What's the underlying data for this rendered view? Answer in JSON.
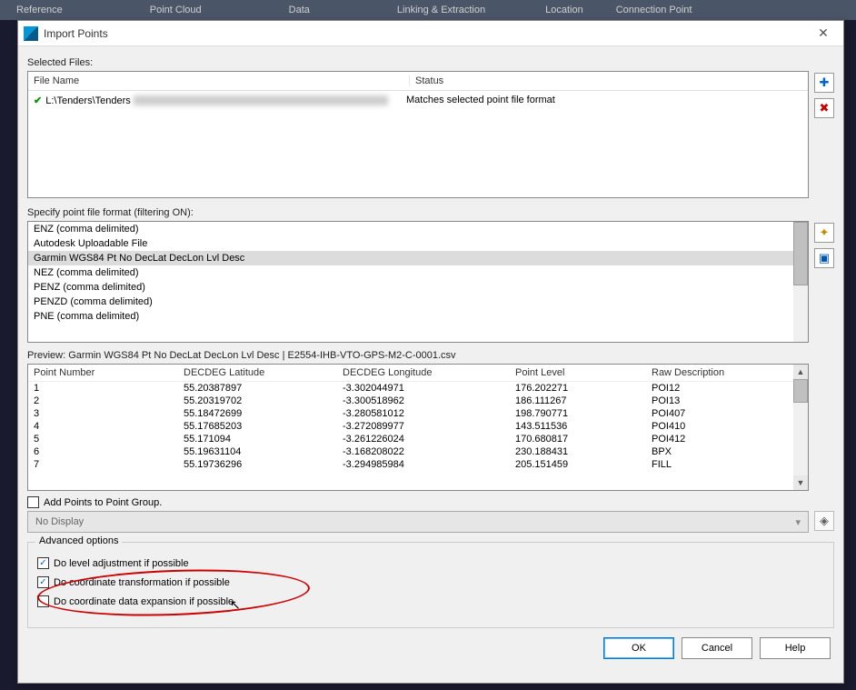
{
  "ribbon": {
    "items": [
      "Reference",
      "Point Cloud",
      "Data",
      "Linking & Extraction",
      "Location",
      "Connection Point"
    ]
  },
  "dialog": {
    "title": "Import Points",
    "close": "✕",
    "selected_files_label": "Selected Files:",
    "file_headers": {
      "name": "File Name",
      "status": "Status"
    },
    "files": [
      {
        "name": "L:\\Tenders\\Tenders",
        "status": "Matches selected point file format"
      }
    ],
    "side_add": "✚",
    "side_remove": "✖",
    "format_label": "Specify point file format (filtering ON):",
    "formats": [
      "ENZ (comma delimited)",
      "Autodesk Uploadable File",
      "Garmin WGS84 Pt No DecLat DecLon Lvl Desc",
      "NEZ (comma delimited)",
      "PENZ (comma delimited)",
      "PENZD (comma delimited)",
      "PNE (comma delimited)"
    ],
    "format_selected_index": 2,
    "side_fmt_a": "✦",
    "side_fmt_b": "▣",
    "preview_label": "Preview: Garmin WGS84 Pt No DecLat DecLon Lvl Desc | E2554-IHB-VTO-GPS-M2-C-0001.csv",
    "preview_headers": {
      "num": "Point Number",
      "lat": "DECDEG Latitude",
      "lon": "DECDEG Longitude",
      "lvl": "Point Level",
      "desc": "Raw Description"
    },
    "rows": [
      {
        "n": "1",
        "lat": "55.20387897",
        "lon": "-3.302044971",
        "lvl": "176.202271",
        "d": "POI12"
      },
      {
        "n": "2",
        "lat": "55.20319702",
        "lon": "-3.300518962",
        "lvl": "186.111267",
        "d": "POI13"
      },
      {
        "n": "3",
        "lat": "55.18472699",
        "lon": "-3.280581012",
        "lvl": "198.790771",
        "d": "POI407"
      },
      {
        "n": "4",
        "lat": "55.17685203",
        "lon": "-3.272089977",
        "lvl": "143.511536",
        "d": "POI410"
      },
      {
        "n": "5",
        "lat": "55.171094",
        "lon": "-3.261226024",
        "lvl": "170.680817",
        "d": "POI412"
      },
      {
        "n": "6",
        "lat": "55.19631104",
        "lon": "-3.168208022",
        "lvl": "230.188431",
        "d": "BPX"
      },
      {
        "n": "7",
        "lat": "55.19736296",
        "lon": "-3.294985984",
        "lvl": "205.151459",
        "d": "FILL"
      }
    ],
    "add_points_label": "Add Points to Point Group.",
    "dropdown_value": "No Display",
    "side_drop": "◈",
    "advanced": {
      "legend": "Advanced options",
      "opt1": "Do level adjustment if possible",
      "opt2": "Do coordinate transformation if possible",
      "opt3": "Do coordinate data expansion if possible"
    },
    "buttons": {
      "ok": "OK",
      "cancel": "Cancel",
      "help": "Help"
    }
  }
}
